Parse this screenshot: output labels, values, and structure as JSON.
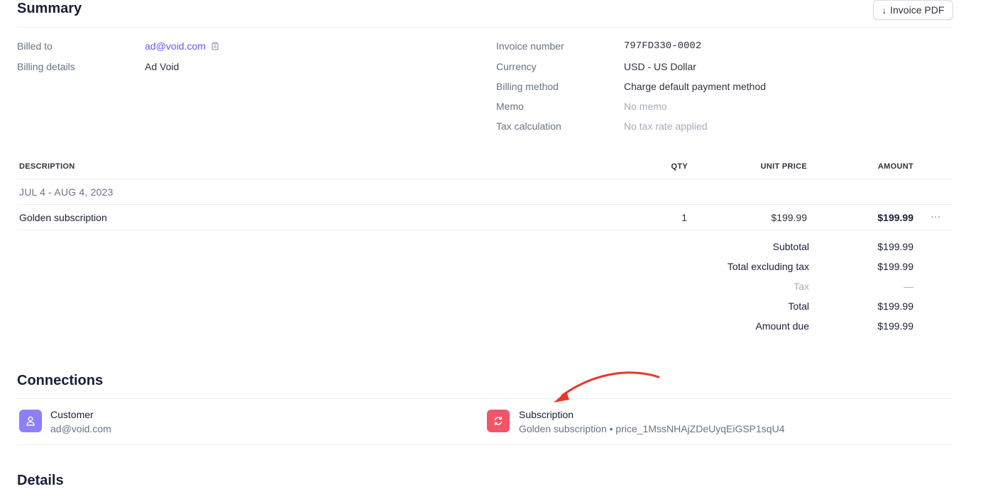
{
  "summary": {
    "title": "Summary",
    "invoice_pdf_label": "Invoice PDF",
    "billed_to_label": "Billed to",
    "billed_to_value": "ad@void.com",
    "billing_details_label": "Billing details",
    "billing_details_value": "Ad Void",
    "invoice_number_label": "Invoice number",
    "invoice_number_value": "797FD330-0002",
    "currency_label": "Currency",
    "currency_value": "USD - US Dollar",
    "billing_method_label": "Billing method",
    "billing_method_value": "Charge default payment method",
    "memo_label": "Memo",
    "memo_value": "No memo",
    "tax_calc_label": "Tax calculation",
    "tax_calc_value": "No tax rate applied"
  },
  "line_items": {
    "headers": {
      "description": "DESCRIPTION",
      "qty": "QTY",
      "unit_price": "UNIT PRICE",
      "amount": "AMOUNT"
    },
    "period": "JUL 4 - AUG 4, 2023",
    "rows": [
      {
        "description": "Golden subscription",
        "qty": "1",
        "unit_price": "$199.99",
        "amount": "$199.99",
        "menu": "···"
      }
    ]
  },
  "totals": [
    {
      "label": "Subtotal",
      "value": "$199.99"
    },
    {
      "label": "Total excluding tax",
      "value": "$199.99"
    },
    {
      "label": "Tax",
      "value": "—"
    },
    {
      "label": "Total",
      "value": "$199.99"
    },
    {
      "label": "Amount due",
      "value": "$199.99"
    }
  ],
  "connections": {
    "title": "Connections",
    "customer": {
      "title": "Customer",
      "subtitle": "ad@void.com"
    },
    "subscription": {
      "title": "Subscription",
      "subtitle": "Golden subscription • price_1MssNHAjZDeUyqEiGSP1sqU4"
    }
  },
  "details": {
    "title": "Details"
  },
  "colors": {
    "accent": "#625afa",
    "customer_icon_bg": "#8d7ffa",
    "subscription_icon_bg": "#f2546a",
    "annotation_arrow": "#e8372c"
  }
}
